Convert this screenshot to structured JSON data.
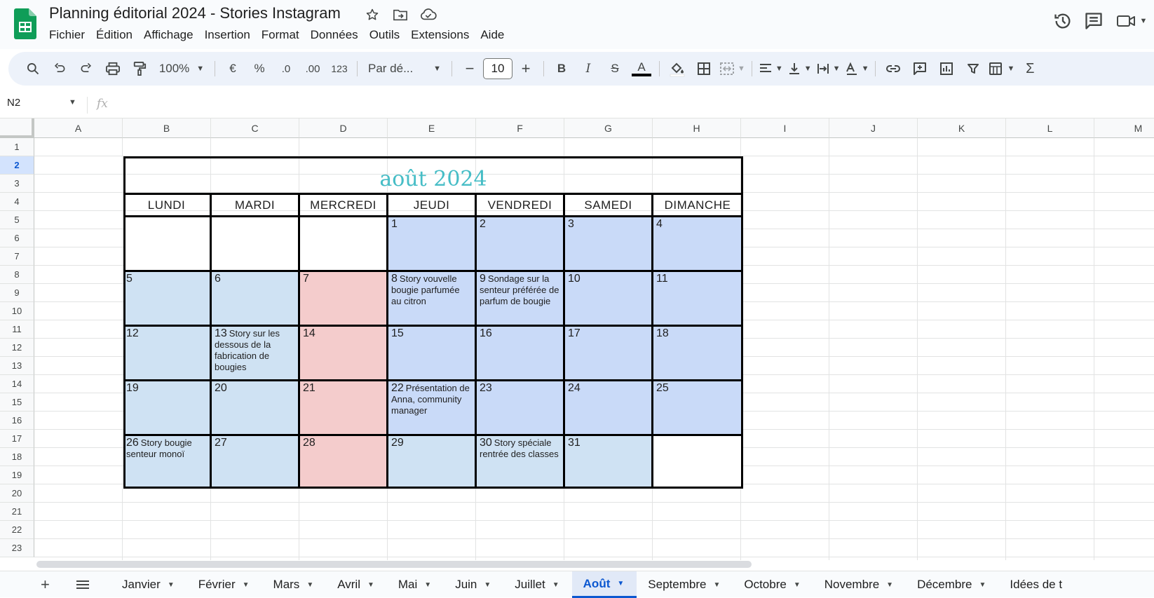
{
  "app": {
    "title": "Planning éditorial 2024 - Stories Instagram",
    "menu": [
      "Fichier",
      "Édition",
      "Affichage",
      "Insertion",
      "Format",
      "Données",
      "Outils",
      "Extensions",
      "Aide"
    ],
    "brand_color": "#0f9d58"
  },
  "toolbar": {
    "zoom": "100%",
    "currency": "€",
    "percent": "%",
    "dec_decrease": ".0",
    "dec_increase": ".00",
    "number_format": "123",
    "font": "Par dé...",
    "font_size": "10",
    "minus": "−",
    "plus": "+",
    "bold": "B",
    "italic": "I",
    "strike": "S",
    "text_color": "A",
    "sum": "Σ"
  },
  "formula_bar": {
    "cell_ref": "N2",
    "fx": "fx"
  },
  "grid": {
    "columns": [
      "A",
      "B",
      "C",
      "D",
      "E",
      "F",
      "G",
      "H",
      "I",
      "J",
      "K",
      "L",
      "M"
    ],
    "rows": [
      "1",
      "2",
      "3",
      "4",
      "5",
      "6",
      "7",
      "8",
      "9",
      "10",
      "11",
      "12",
      "13",
      "14",
      "15",
      "16",
      "17",
      "18",
      "19",
      "20",
      "21",
      "22",
      "23"
    ],
    "selected_row": "2"
  },
  "calendar": {
    "title": "août 2024",
    "title_color": "#46bdc6",
    "days": [
      "LUNDI",
      "MARDI",
      "MERCREDI",
      "JEUDI",
      "VENDREDI",
      "SAMEDI",
      "DIMANCHE"
    ],
    "colors": {
      "blue": "#cfe2f3",
      "periwinkle": "#c9daf8",
      "pink": "#f4cccc"
    },
    "weeks": [
      [
        {
          "num": "",
          "text": "",
          "color": "blank"
        },
        {
          "num": "",
          "text": "",
          "color": "blank"
        },
        {
          "num": "",
          "text": "",
          "color": "blank"
        },
        {
          "num": "1",
          "text": "",
          "color": "periw"
        },
        {
          "num": "2",
          "text": "",
          "color": "periw"
        },
        {
          "num": "3",
          "text": "",
          "color": "periw"
        },
        {
          "num": "4",
          "text": "",
          "color": "periw"
        }
      ],
      [
        {
          "num": "5",
          "text": "",
          "color": "blue"
        },
        {
          "num": "6",
          "text": "",
          "color": "blue"
        },
        {
          "num": "7",
          "text": "",
          "color": "pink"
        },
        {
          "num": "8",
          "text": "Story vouvelle bougie parfumée au citron",
          "color": "periw"
        },
        {
          "num": "9",
          "text": "Sondage sur la senteur préférée de parfum de bougie",
          "color": "periw"
        },
        {
          "num": "10",
          "text": "",
          "color": "periw"
        },
        {
          "num": "11",
          "text": "",
          "color": "periw"
        }
      ],
      [
        {
          "num": "12",
          "text": "",
          "color": "blue"
        },
        {
          "num": "13",
          "text": "Story sur les dessous de la fabrication de bougies",
          "color": "blue"
        },
        {
          "num": "14",
          "text": "",
          "color": "pink"
        },
        {
          "num": "15",
          "text": "",
          "color": "periw"
        },
        {
          "num": "16",
          "text": "",
          "color": "periw"
        },
        {
          "num": "17",
          "text": "",
          "color": "periw"
        },
        {
          "num": "18",
          "text": "",
          "color": "periw"
        }
      ],
      [
        {
          "num": "19",
          "text": "",
          "color": "blue"
        },
        {
          "num": "20",
          "text": "",
          "color": "blue"
        },
        {
          "num": "21",
          "text": "",
          "color": "pink"
        },
        {
          "num": "22",
          "text": "Présentation de Anna, community manager",
          "color": "periw"
        },
        {
          "num": "23",
          "text": "",
          "color": "periw"
        },
        {
          "num": "24",
          "text": "",
          "color": "periw"
        },
        {
          "num": "25",
          "text": "",
          "color": "periw"
        }
      ],
      [
        {
          "num": "26",
          "text": "Story bougie senteur monoï",
          "color": "blue"
        },
        {
          "num": "27",
          "text": "",
          "color": "blue"
        },
        {
          "num": "28",
          "text": "",
          "color": "pink"
        },
        {
          "num": "29",
          "text": "",
          "color": "blue"
        },
        {
          "num": "30",
          "text": "Story spéciale rentrée des classes",
          "color": "blue"
        },
        {
          "num": "31",
          "text": "",
          "color": "blue"
        },
        {
          "num": "",
          "text": "",
          "color": "blank"
        }
      ]
    ]
  },
  "sheets": {
    "tabs": [
      "Janvier",
      "Février",
      "Mars",
      "Avril",
      "Mai",
      "Juin",
      "Juillet",
      "Août",
      "Septembre",
      "Octobre",
      "Novembre",
      "Décembre",
      "Idées de t"
    ],
    "active": "Août"
  }
}
